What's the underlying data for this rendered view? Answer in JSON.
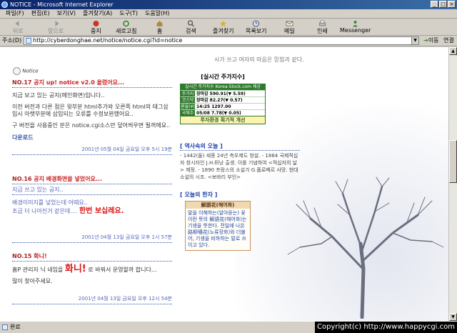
{
  "window": {
    "title": "NOTICE - Microsoft Internet Explorer",
    "controls": [
      "_",
      "□",
      "×"
    ]
  },
  "menu": [
    "파일(F)",
    "편집(E)",
    "보기(V)",
    "즐겨찾기(A)",
    "도구(T)",
    "도움말(H)"
  ],
  "toolbar": {
    "back": "뒤로",
    "forward": "앞으로",
    "stop": "중지",
    "refresh": "새로고침",
    "home": "홈",
    "search": "검색",
    "favorites": "즐겨찾기",
    "history": "목록보기",
    "mail": "메일",
    "print": "인쇄",
    "messenger": "Messenger"
  },
  "address": {
    "label": "주소(D)",
    "url": "http://cyberdonghae.net/notice/notice.cgi?id=notice",
    "go": "이동",
    "links": "연결"
  },
  "page": {
    "quote": "시가 쓰고 여자의 마음은 믿힘과 같다.",
    "logo": "Notice",
    "posts": [
      {
        "num": "NO.17",
        "title": "공지 up! notice v2.0 올렸어요...",
        "lines": [
          "지금 보고 있는 공지(메인화면)입니다..",
          "이전 버전과 다른 점은 윗부분 html추가와 오른쪽 html의 태그삽입시 아랫부분에 삽입되는 오류를 수정보완했어요..",
          "구 버전을 사용중인 분은 notice.cgi소스만 덮어씌우면 될꺼에요.."
        ],
        "link": "다운로드",
        "date": "2001년 05월 04일 금요일 오후 5시 19분"
      },
      {
        "num": "NO.16",
        "title": "공지 배경화면을 넣었어요...",
        "sub": "지금 쓰고 있는 공지..",
        "lines": [
          "배경이미지를 넣었는데 어때요..",
          "조금 더 나아진거 같은데...."
        ],
        "highlight": "한번 보십레요.",
        "date": "2001년 04월 13일 금요일 오후 1시 57분"
      },
      {
        "num": "NO.15",
        "title": "화니!",
        "lines_pre": "홈P 관리자 닉 네임을",
        "big": "화니!",
        "lines_post": "로 바꿔서 운영할까 합니다...",
        "line2": "많이 찾아주세요.",
        "date": "2001년 04월 13일 금요일 오후 12시 54분"
      }
    ],
    "stock": {
      "header": "[실시간 주가지수]",
      "bar": "실시간 주가지수 Korea-Stock.com 제공",
      "rows": [
        [
          "주가지수",
          "장마감  590.91(▼ 5.59)"
        ],
        [
          "코스닥",
          "장마감   82.27(▼ 0.57)"
        ],
        [
          "환율(¥)",
          "14:25 1297.00"
        ],
        [
          "국채수익",
          "05/08   7.78(▼ 0.05)"
        ]
      ],
      "footer": "투자환경 획기적 개선"
    },
    "history": {
      "header": "[ 역사속의 오늘 ]",
      "text": "- 1442(둘) 세종 24년 측우제도 창설. - 1864 국제적십자 창시자인 J.H.뒤낭 출생. 이를 기념하여 <적십자의 날> 제정. - 1890 프랑스의 소설가 G.플로베르 사망. 현대소설의 시조. <보바리 부인>"
    },
    "hanja": {
      "header": "[ 오늘의 한자 ]",
      "title": "解語花(해어화)",
      "text": "말을 이해하는(알아듣는) 꽃이란 뜻의 解語花(해어화)는 기생을 뜻한다. 전일에 나온 路柳墻花(노류장화)와 더불어, 기생을 비하하는 말로 쓰이고 있다."
    }
  },
  "status": {
    "text": "완료",
    "copyright": "Copyright(c) http://www.happycgi.com"
  }
}
